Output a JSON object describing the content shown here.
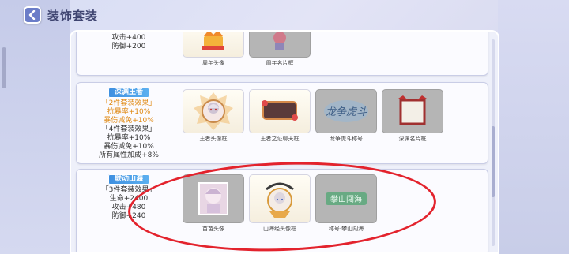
{
  "header": {
    "title": "装饰套装"
  },
  "top_set": {
    "stats": [
      "攻击+400",
      "防御+200"
    ],
    "items": [
      {
        "label": "周年头像"
      },
      {
        "label": "周年名片框"
      }
    ]
  },
  "abyss_set": {
    "badge": "深渊王者",
    "lines": [
      {
        "text": "「2件套装效果」",
        "tone": "orange"
      },
      {
        "text": "抗暴率+10%",
        "tone": "orange"
      },
      {
        "text": "暴伤减免+10%",
        "tone": "orange"
      },
      {
        "text": "「4件套装效果」",
        "tone": "normal"
      },
      {
        "text": "抗暴率+10%",
        "tone": "normal"
      },
      {
        "text": "暴伤减免+10%",
        "tone": "normal"
      },
      {
        "text": "所有属性加成+8%",
        "tone": "normal"
      }
    ],
    "items": [
      {
        "label": "王者头像框",
        "icon": "avatar-frame-icon"
      },
      {
        "label": "王者之证聊天框",
        "icon": "chat-frame-icon"
      },
      {
        "label": "龙争虎斗称号",
        "icon": "title-badge-icon",
        "emblem_text": "龙争虎斗"
      },
      {
        "label": "深渊名片框",
        "icon": "card-frame-icon"
      }
    ]
  },
  "shanhai_set": {
    "badge": "联动山海",
    "lines": [
      {
        "text": "「3件套装效果」",
        "tone": "normal"
      },
      {
        "text": "生命+2400",
        "tone": "normal"
      },
      {
        "text": "攻击+480",
        "tone": "normal"
      },
      {
        "text": "防御+240",
        "tone": "normal"
      }
    ],
    "items": [
      {
        "label": "苗苗头像",
        "icon": "avatar-icon"
      },
      {
        "label": "山海经头像框",
        "icon": "avatar-frame-icon"
      },
      {
        "label": "称号·攀山闯海",
        "icon": "title-badge-icon",
        "emblem_text": "攀山闯海"
      }
    ]
  },
  "colors": {
    "accent": "#3e8fe0",
    "highlight": "#e3232d",
    "orange": "#e08a14"
  }
}
